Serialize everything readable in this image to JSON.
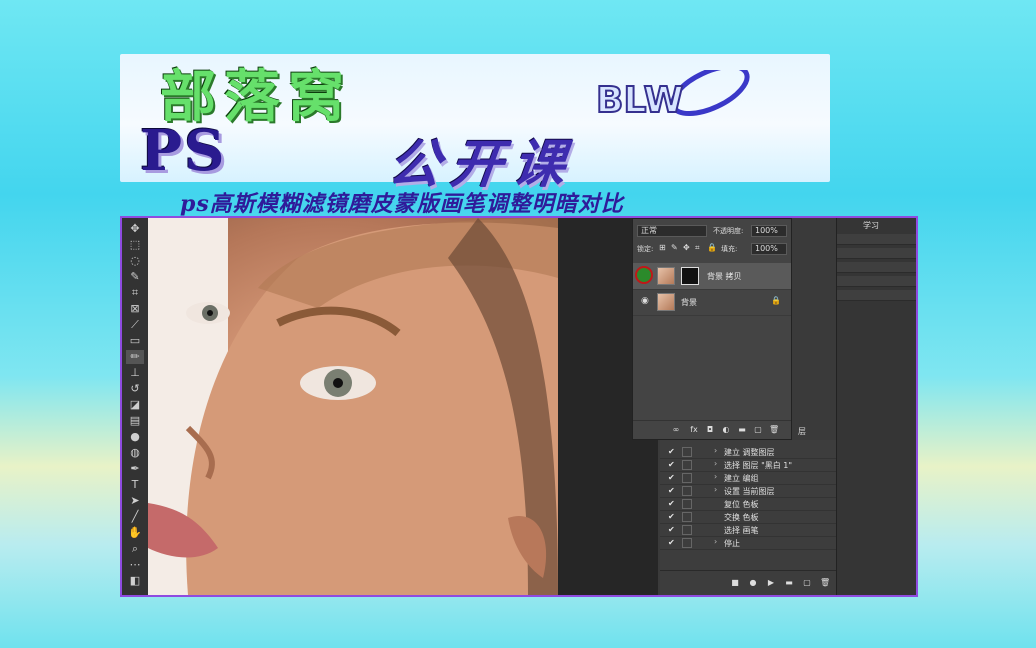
{
  "banner": {
    "brand_title": "部落窝",
    "logo_text": "BLW",
    "ps_word": "PS",
    "course_word": "公开课",
    "subtitle": "ps高斯模糊滤镜磨皮蒙版画笔调整明暗对比"
  },
  "ps": {
    "toolbar_icons": [
      "move-icon",
      "marquee-icon",
      "lasso-icon",
      "quick-select-icon",
      "crop-icon",
      "frame-icon",
      "eyedropper-icon",
      "patch-icon",
      "brush-icon",
      "stamp-icon",
      "history-brush-icon",
      "eraser-icon",
      "gradient-icon",
      "blur-icon",
      "dodge-icon",
      "pen-icon",
      "type-icon",
      "path-select-icon",
      "line-icon",
      "hand-icon",
      "zoom-icon",
      "more-icon",
      "fg-bg-colors-icon",
      "quick-mask-icon"
    ],
    "layers": {
      "blend_mode": "正常",
      "opacity_label": "不透明度:",
      "opacity_value": "100%",
      "lock_label": "锁定:",
      "fill_label": "填充:",
      "fill_value": "100%",
      "items": [
        {
          "name": "背景 拷贝"
        },
        {
          "name": "背景"
        }
      ]
    },
    "actions": {
      "items": [
        {
          "label": "建立 调整图层"
        },
        {
          "label": "选择 图层 \"黑白 1\""
        },
        {
          "label": "建立 编组"
        },
        {
          "label": "设置 当前图层"
        },
        {
          "label": "复位 色板"
        },
        {
          "label": "交换 色板"
        },
        {
          "label": "选择 画笔"
        },
        {
          "label": "停止"
        }
      ],
      "partial_above": "层"
    },
    "right_panel_label": "学习"
  }
}
